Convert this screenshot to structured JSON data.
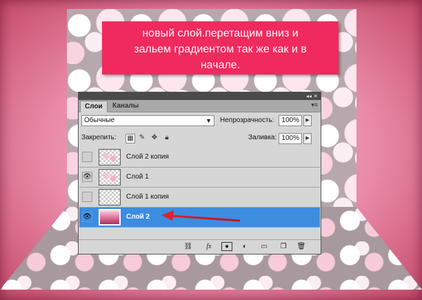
{
  "caption": {
    "line1": "новый слой.перетащим вниз и",
    "line2": "зальем градиентом так же как и в",
    "line3": "начале."
  },
  "panel": {
    "tabs": [
      {
        "label": "Слои",
        "active": true
      },
      {
        "label": "Каналы",
        "active": false
      }
    ],
    "blend_mode": "Обычные",
    "opacity_label": "Непрозрачность:",
    "opacity_value": "100%",
    "lock_label": "Закрепить:",
    "fill_label": "Заливка:",
    "fill_value": "100%",
    "layers": [
      {
        "name": "Слой 2 копия",
        "visible": false,
        "selected": false,
        "thumb": "flowers"
      },
      {
        "name": "Слой 1",
        "visible": true,
        "selected": false,
        "thumb": "flowers"
      },
      {
        "name": "Слой 1 копия",
        "visible": false,
        "selected": false,
        "thumb": "transparent"
      },
      {
        "name": "Слой 2",
        "visible": true,
        "selected": true,
        "thumb": "gradient"
      }
    ]
  },
  "colors": {
    "caption_bg": "#f02a5e",
    "selection": "#3c8de0",
    "arrow": "#e0202a"
  }
}
